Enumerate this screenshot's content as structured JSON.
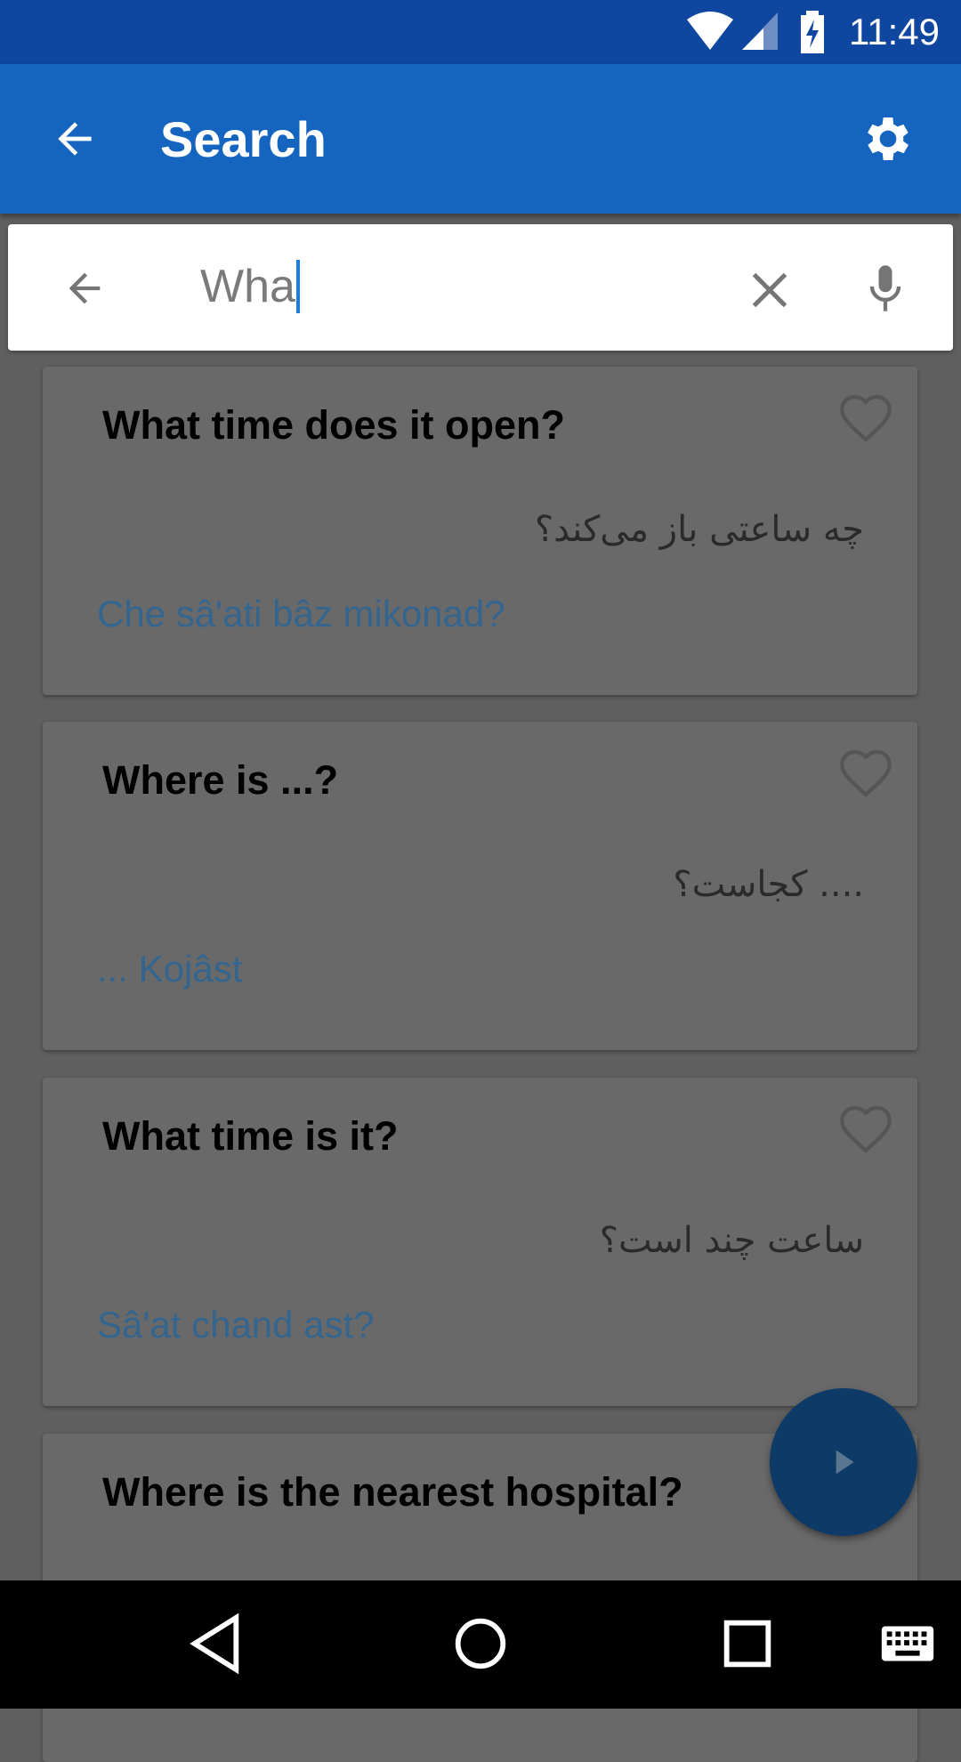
{
  "status_bar": {
    "time": "11:49",
    "icons": [
      "wifi-icon",
      "signal-icon",
      "battery-charging-icon"
    ]
  },
  "app_bar": {
    "title": "Search",
    "back_icon": "arrow-back-icon",
    "settings_icon": "gear-icon"
  },
  "search": {
    "value": "Wha",
    "back_icon": "arrow-back-icon",
    "clear_icon": "close-icon",
    "voice_icon": "mic-icon"
  },
  "results": [
    {
      "english": "What time does it open?",
      "persian": "چه ساعتی باز می‌کند؟",
      "transliteration": "Che sâ'ati bâz mikonad?",
      "favorite": false
    },
    {
      "english": "Where is ...?",
      "persian": ".... کجاست؟",
      "transliteration": "... Kojâst",
      "favorite": false
    },
    {
      "english": "What time is it?",
      "persian": "ساعت چند است؟",
      "transliteration": "Sâ'at chand ast?",
      "favorite": false
    },
    {
      "english": "Where is the nearest hospital?"
    }
  ],
  "fab": {
    "icon": "play-icon"
  },
  "nav_bar": {
    "icons": [
      "back-triangle-icon",
      "home-circle-icon",
      "recents-square-icon",
      "keyboard-icon"
    ]
  },
  "colors": {
    "status_bar": "#0e46a0",
    "app_bar": "#1565c0",
    "fab": "#0d3a66",
    "transliteration": "#33658f",
    "cursor": "#1e7be0"
  }
}
